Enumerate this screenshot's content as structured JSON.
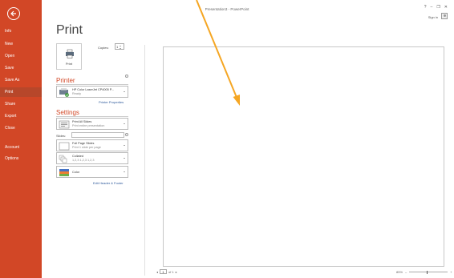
{
  "window": {
    "title": "Presentation3 - PowerPoint",
    "help": "?",
    "minimize": "–",
    "restore": "❐",
    "close": "✕",
    "signin": "Sign in"
  },
  "sidebar": {
    "items": [
      {
        "label": "Info"
      },
      {
        "label": "New"
      },
      {
        "label": "Open"
      },
      {
        "label": "Save"
      },
      {
        "label": "Save As"
      },
      {
        "label": "Print"
      },
      {
        "label": "Share"
      },
      {
        "label": "Export"
      },
      {
        "label": "Close"
      },
      {
        "label": "Account"
      },
      {
        "label": "Options"
      }
    ],
    "active": "Print"
  },
  "print": {
    "title": "Print",
    "button_label": "Print",
    "copies_label": "Copies:",
    "copies_value": "1",
    "printer_title": "Printer",
    "printer_name": "HP Color LaserJet CP4005 P...",
    "printer_status": "Ready",
    "printer_properties": "Printer Properties",
    "settings_title": "Settings",
    "slides_range_main": "Print All Slides",
    "slides_range_sub": "Print entire presentation",
    "slides_label": "Slides:",
    "layout_main": "Full Page Slides",
    "layout_sub": "Print 1 slide per page",
    "collate_main": "Collated",
    "collate_sub": "1,2,3   1,2,3   1,2,3",
    "color_main": "Color",
    "edit_header_footer": "Edit Header & Footer"
  },
  "footer": {
    "page_value": "1",
    "page_of": "of 1",
    "zoom": "85%"
  },
  "colors": {
    "accent": "#d24726",
    "link": "#2b579a",
    "annotation": "#f5a623"
  }
}
